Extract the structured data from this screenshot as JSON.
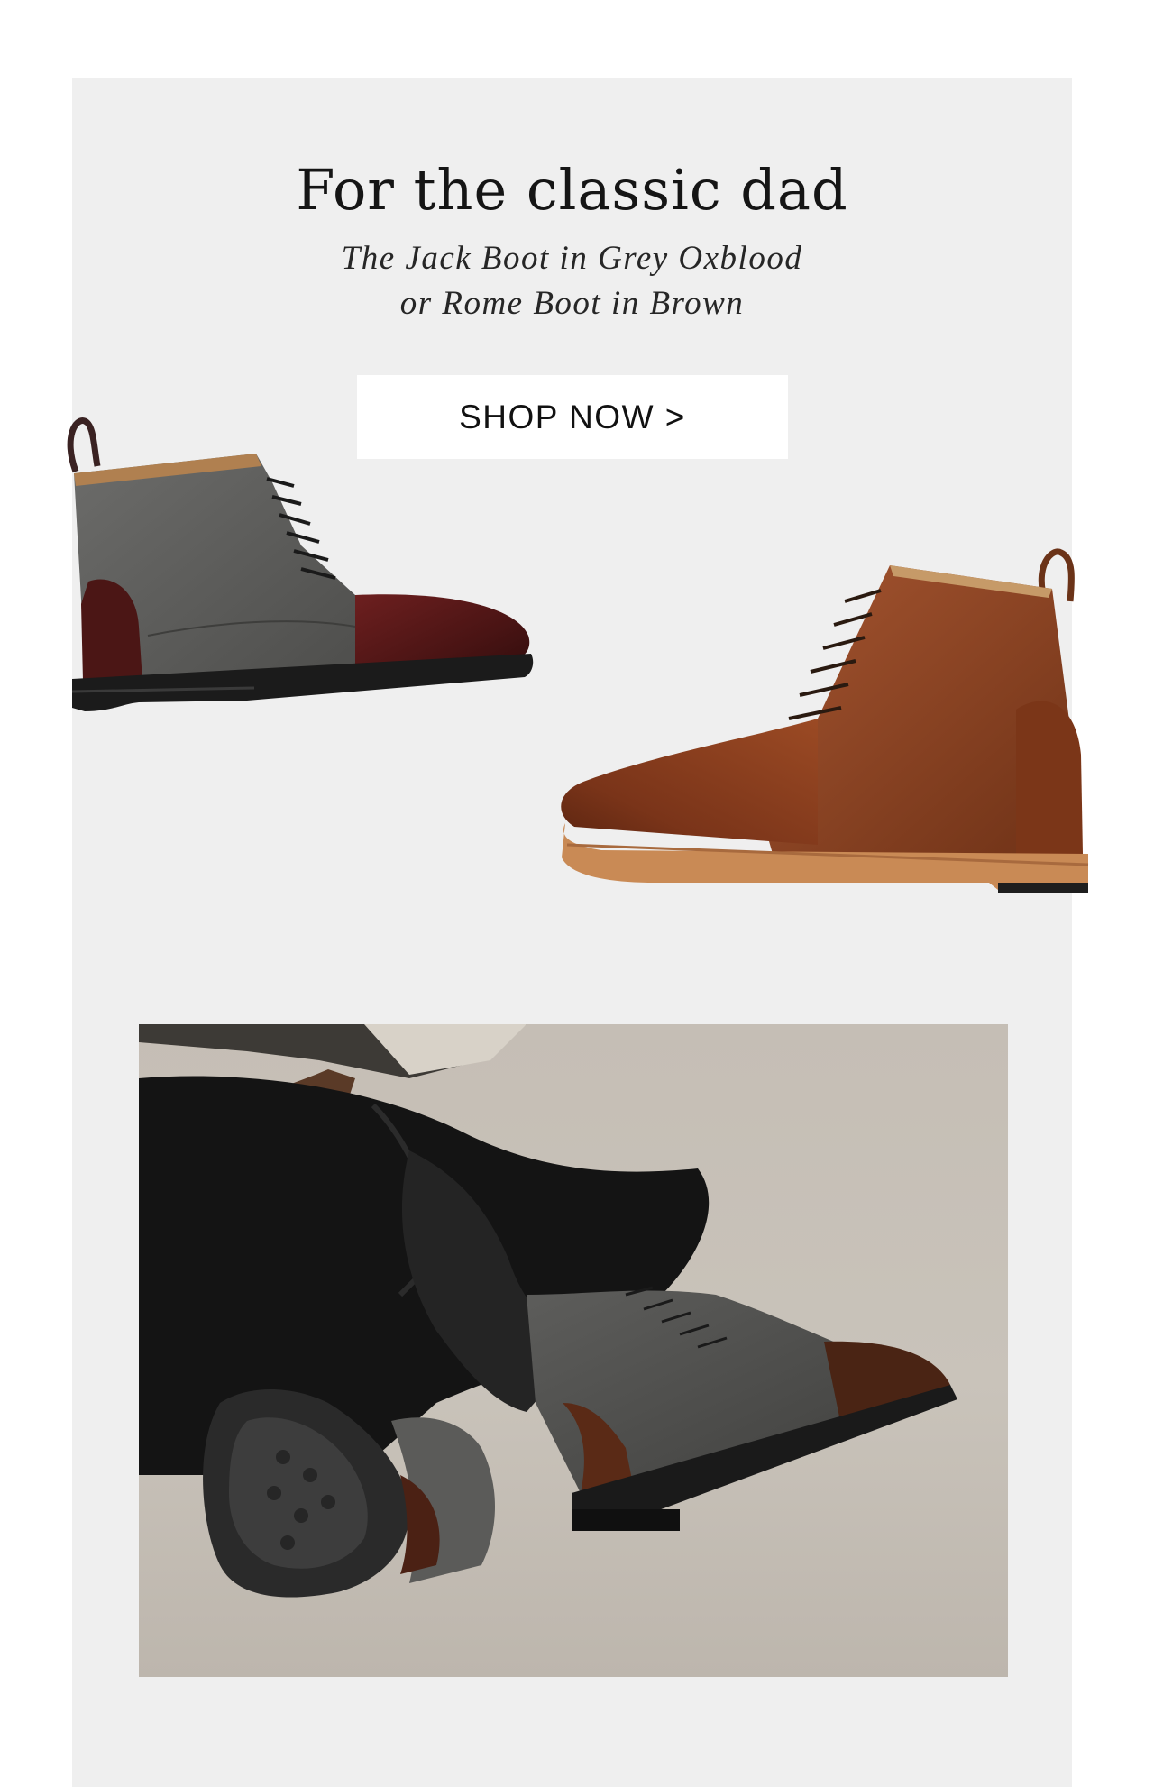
{
  "promo": {
    "headline": "For the classic dad",
    "subline_1": "The Jack Boot in Grey Oxblood",
    "subline_2": "or Rome Boot in Brown",
    "cta_label": "SHOP NOW >"
  },
  "products": [
    {
      "image": "grey-oxblood-jack-boot"
    },
    {
      "image": "brown-rome-boot"
    }
  ],
  "lifestyle_image": "model-wearing-jack-boots",
  "colors": {
    "panel_bg": "#efefef",
    "page_bg": "#ffffff",
    "button_bg": "#ffffff",
    "text": "#151515"
  }
}
